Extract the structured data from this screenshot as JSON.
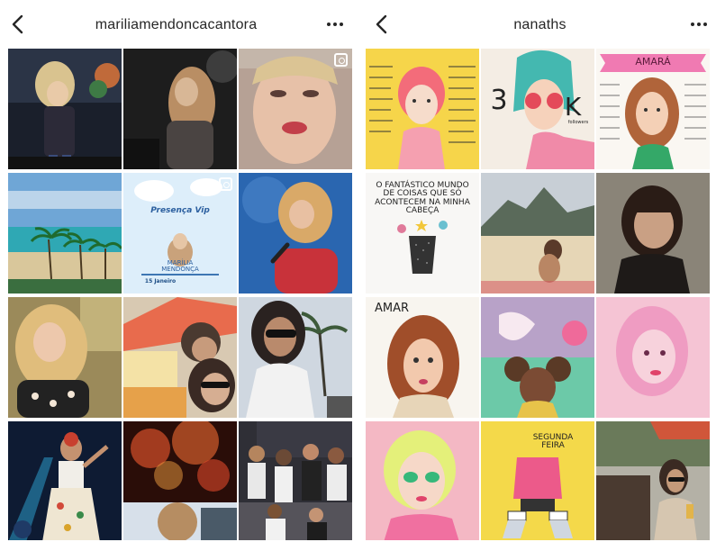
{
  "left": {
    "username": "mariliamendoncacantora",
    "back_icon": "chevron-left-icon",
    "more_icon": "more-horizontal-icon",
    "post_art": {
      "title": "Presença Vip",
      "name_line1": "MARÍLIA",
      "name_line2": "MENDONÇA",
      "date": "15 Janeiro"
    }
  },
  "right": {
    "username": "nanaths",
    "back_icon": "chevron-left-icon",
    "more_icon": "more-horizontal-icon",
    "post_amara_1": "AMARÁ",
    "post_followers_3": "3",
    "post_followers_k": "K",
    "post_followers_label": "followers",
    "post_mundo": "O FANTÁSTICO MUNDO DE COISAS QUE SÓ ACONTECEM NA MINHA CABEÇA",
    "post_amara_2": "AMAR",
    "post_segunda": "SEGUNDA FEIRA"
  },
  "colors": {
    "text": "#262626",
    "background": "#ffffff",
    "divider": "#dbdbdb"
  }
}
